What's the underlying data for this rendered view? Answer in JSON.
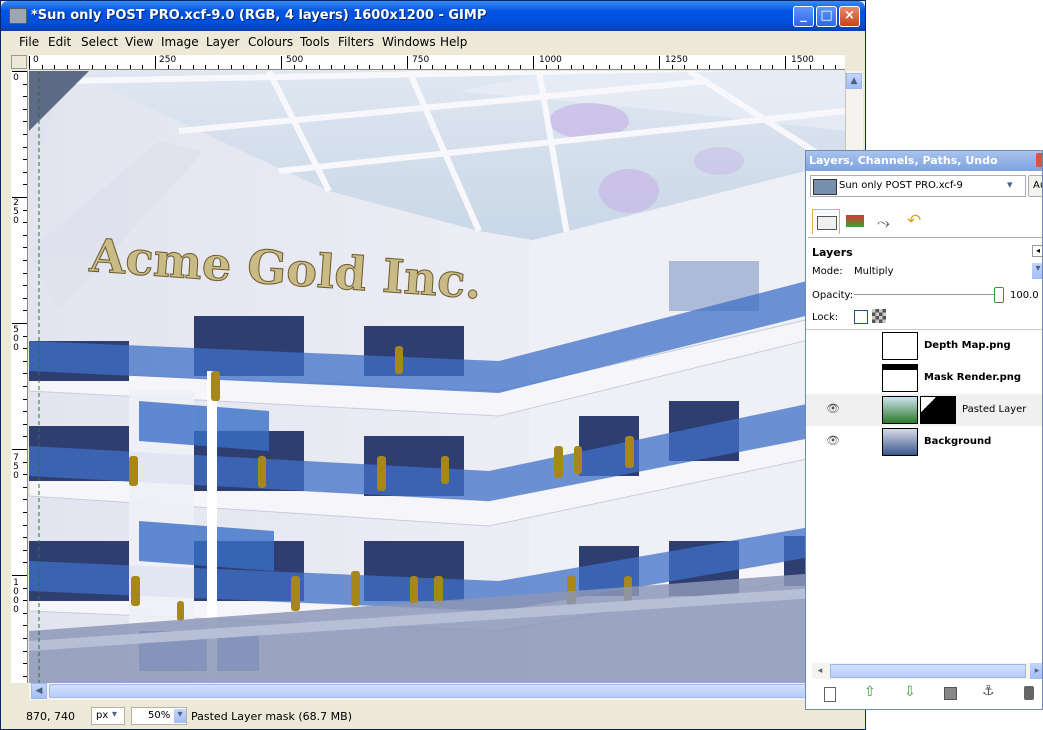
{
  "window": {
    "title": "*Sun only POST PRO.xcf-9.0 (RGB, 4 layers) 1600x1200 - GIMP",
    "minimize_label": "_",
    "maximize_label": "□",
    "close_label": "×"
  },
  "menu": [
    "File",
    "Edit",
    "Select",
    "View",
    "Image",
    "Layer",
    "Colours",
    "Tools",
    "Filters",
    "Windows",
    "Help"
  ],
  "ruler_h_labels": [
    "0",
    "250",
    "500",
    "750",
    "1000",
    "1250",
    "1500"
  ],
  "ruler_v_labels": [
    [
      "0"
    ],
    [
      "2",
      "5",
      "0"
    ],
    [
      "5",
      "0",
      "0"
    ],
    [
      "7",
      "5",
      "0"
    ],
    [
      "1",
      "0",
      "0",
      "0"
    ]
  ],
  "canvas": {
    "sign_text": "Acme Gold Inc."
  },
  "status": {
    "coords": "870, 740",
    "unit": "px",
    "zoom": "50%",
    "message": "Pasted Layer mask (68.7 MB)"
  },
  "dock": {
    "title": "Layers, Channels, Paths, Undo",
    "image_select": "Sun only POST PRO.xcf-9",
    "auto_label": "Aut",
    "panel_title": "Layers",
    "mode_label": "Mode:",
    "mode_value": "Multiply",
    "opacity_label": "Opacity:",
    "opacity_value": "100.0",
    "lock_label": "Lock:",
    "layers": [
      {
        "name": "Depth Map.png",
        "visible": false
      },
      {
        "name": "Mask Render.png",
        "visible": false
      },
      {
        "name": "Pasted Layer",
        "visible": true
      },
      {
        "name": "Background",
        "visible": true
      }
    ]
  }
}
